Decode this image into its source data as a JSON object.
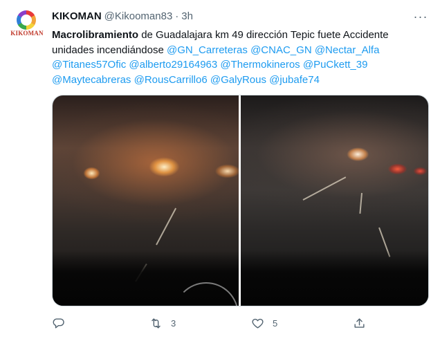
{
  "author": {
    "name": "KIKOMAN",
    "handle": "@Kikooman83",
    "separator": "·",
    "time": "3h",
    "avatar_brand": "KIKOMAN"
  },
  "tweet": {
    "bold_lead": "Macrolibramiento",
    "text_rest": " de Guadalajara km 49 dirección Tepic fuete Accidente unidades incendiándose ",
    "mentions": [
      "@GN_Carreteras",
      "@CNAC_GN",
      "@Nectar_Alfa",
      "@Titanes57Ofic",
      "@alberto29164963",
      "@Thermokineros",
      "@PuCkett_39",
      "@Maytecabreras",
      "@RousCarrillo6",
      "@GalyRous",
      "@jubafe74"
    ]
  },
  "actions": {
    "reply_icon": "reply-icon",
    "retweet_icon": "retweet-icon",
    "retweet_count": "3",
    "like_icon": "heart-icon",
    "like_count": "5",
    "share_icon": "share-icon"
  },
  "colors": {
    "accent": "#1d9bf0",
    "secondary_text": "#536471",
    "brand_red": "#c0392b"
  }
}
